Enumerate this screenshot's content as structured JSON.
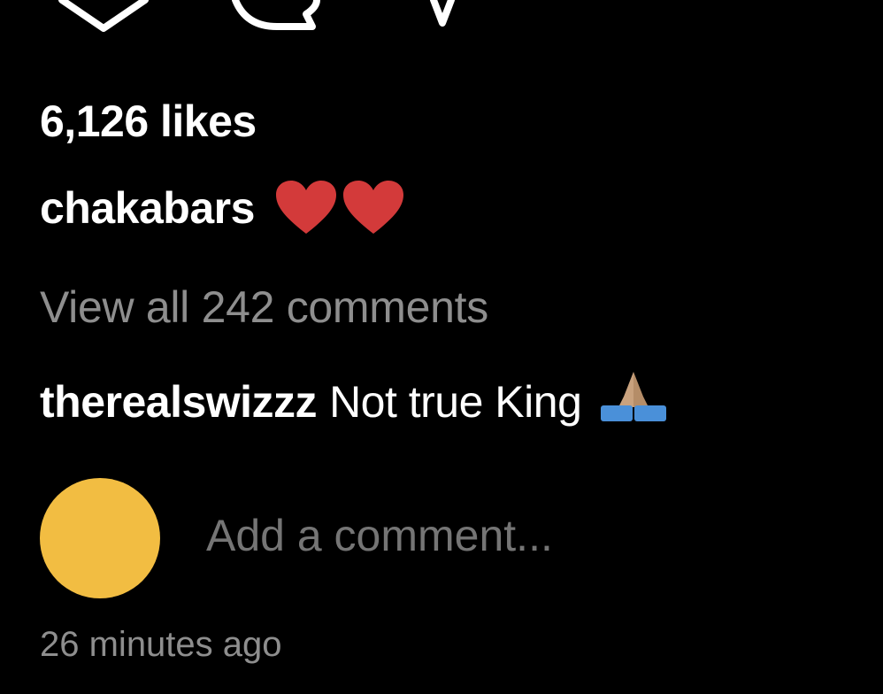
{
  "post": {
    "likes_text": "6,126 likes",
    "caption_user": "chakabars",
    "caption_emojis": [
      "red-heart",
      "red-heart"
    ],
    "view_all_comments": "View all 242 comments",
    "comment": {
      "user": "therealswizzz",
      "text": "Not true King",
      "emoji": "folded-hands"
    },
    "add_comment_placeholder": "Add a comment...",
    "timestamp": "26 minutes ago"
  },
  "icons": [
    "heart-icon",
    "comment-icon",
    "share-icon"
  ],
  "colors": {
    "background": "#000000",
    "primary_text": "#ffffff",
    "secondary_text": "#8e8e8e",
    "heart": "#d33a3a",
    "avatar": "#f2bd42"
  }
}
